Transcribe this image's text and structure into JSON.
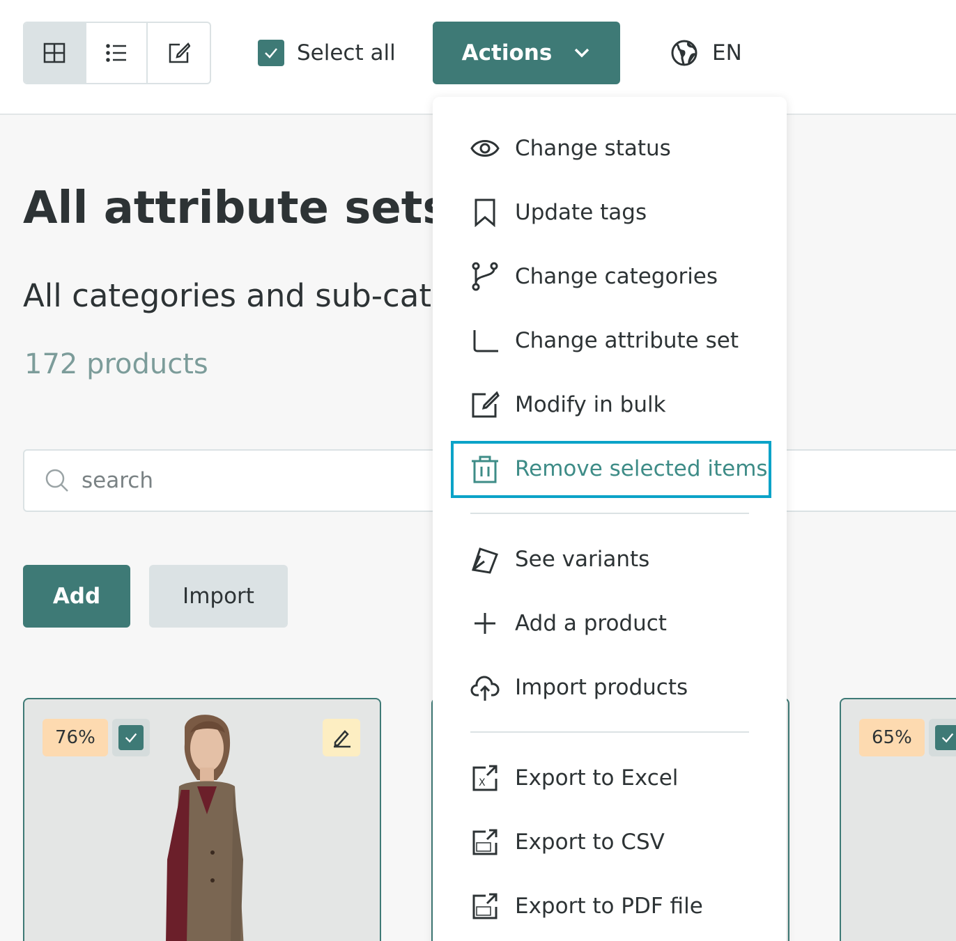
{
  "toolbar": {
    "view_modes": [
      {
        "icon": "grid-icon",
        "active": true
      },
      {
        "icon": "list-icon",
        "active": false
      },
      {
        "icon": "edit-square-icon",
        "active": false
      }
    ],
    "select_all_label": "Select all",
    "actions_label": "Actions",
    "language": "EN"
  },
  "main": {
    "title": "All attribute sets",
    "subtitle": "All categories and sub-categories",
    "product_count": "172 products",
    "search_placeholder": "search",
    "add_label": "Add",
    "import_label": "Import"
  },
  "cards": [
    {
      "percent": "76%",
      "checked": true
    },
    {
      "percent": "65%",
      "checked": true
    }
  ],
  "menu": {
    "items": [
      {
        "label": "Change status",
        "icon": "eye-icon"
      },
      {
        "label": "Update tags",
        "icon": "bookmark-icon"
      },
      {
        "label": "Change categories",
        "icon": "branch-icon"
      },
      {
        "label": "Change attribute set",
        "icon": "corner-icon"
      },
      {
        "label": "Modify in bulk",
        "icon": "edit-square-icon"
      },
      {
        "label": "Remove selected items",
        "icon": "trash-icon",
        "highlighted": true
      },
      {
        "label": "See variants",
        "icon": "swatch-icon"
      },
      {
        "label": "Add a product",
        "icon": "plus-icon"
      },
      {
        "label": "Import products",
        "icon": "cloud-upload-icon"
      },
      {
        "label": "Export to Excel",
        "icon": "excel-export-icon"
      },
      {
        "label": "Export to CSV",
        "icon": "csv-export-icon"
      },
      {
        "label": "Export to PDF file",
        "icon": "pdf-export-icon"
      }
    ]
  },
  "colors": {
    "primary": "#3e7a76",
    "highlight_border": "#0ba3c8",
    "percent_badge": "#fddab0",
    "edit_badge": "#fdeec2"
  }
}
